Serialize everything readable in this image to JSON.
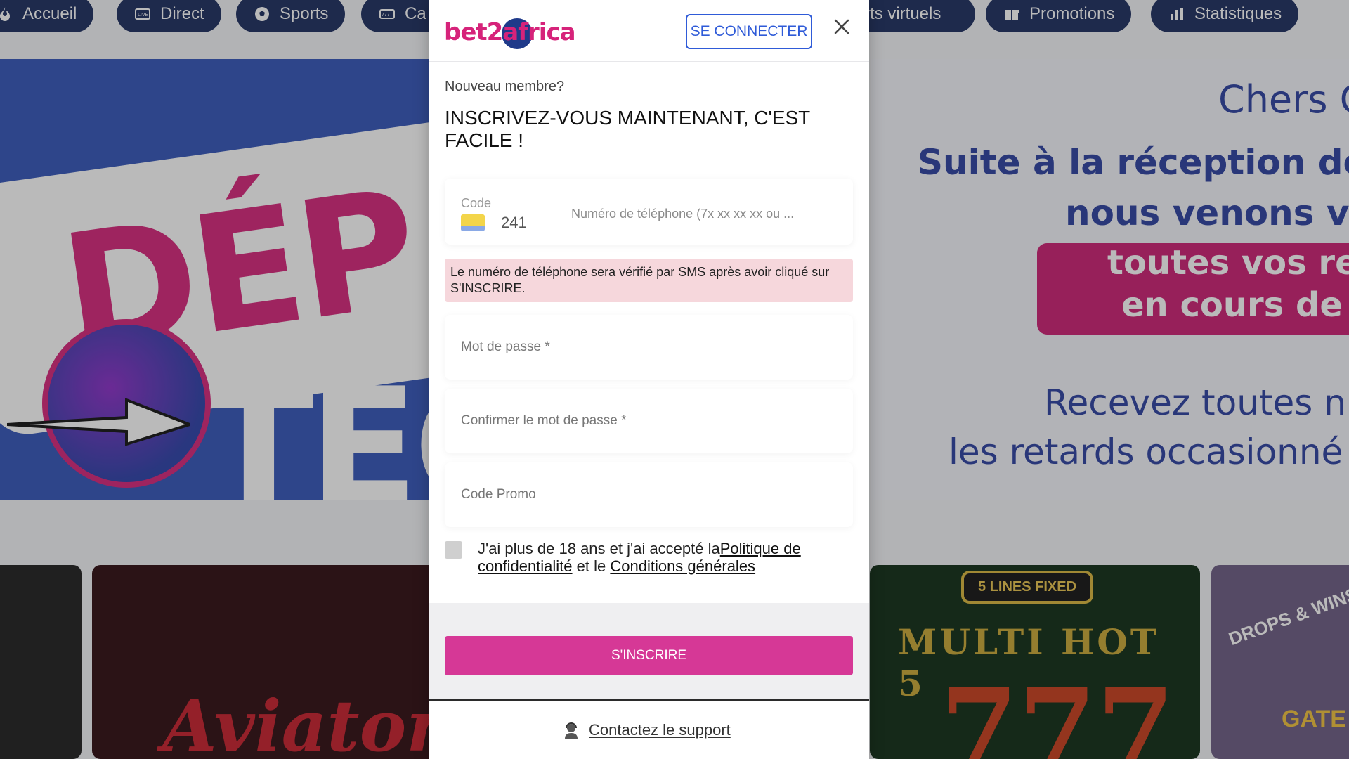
{
  "nav": {
    "items": [
      {
        "label": "Accueil",
        "icon": "fire-icon"
      },
      {
        "label": "Direct",
        "icon": "live-tv-icon"
      },
      {
        "label": "Sports",
        "icon": "soccer-ball-icon"
      },
      {
        "label": "Ca",
        "icon": "slot-machine-icon"
      },
      {
        "label": "rts virtuels",
        "icon": "virtual-sports-icon"
      },
      {
        "label": "Promotions",
        "icon": "gift-icon"
      },
      {
        "label": "Statistiques",
        "icon": "bar-chart-icon"
      }
    ]
  },
  "banner_left": {
    "line1": "DÉP",
    "line2": "TEC"
  },
  "banner_right": {
    "line1": "Chers C",
    "line2": "Suite à la réception de v",
    "line3": "nous venons vo",
    "highlight1": "toutes vos re",
    "highlight2": "en cours de",
    "line4": "Recevez toutes n",
    "line5": "les retards occasionné"
  },
  "games": {
    "aviator": "Aviator",
    "multi_badge": "5 LINES FIXED",
    "multi_title": "MULTI HOT 5",
    "multi_sevens": "777",
    "drops": "DROPS & WINS",
    "gate": "GATE"
  },
  "modal": {
    "logo_text": "bet2africa",
    "connect_label": "SE CONNECTER",
    "subtitle": "Nouveau membre?",
    "headline": "INSCRIVEZ-VOUS MAINTENANT, C'EST FACILE !",
    "phone": {
      "code_label": "Code",
      "code_value": "241",
      "placeholder": "Numéro de téléphone (7x xx xx xx ou ...",
      "flag_colors": [
        "#f3d54a",
        "#f3d54a",
        "#8aa9e6"
      ]
    },
    "sms_note": "Le numéro de téléphone sera vérifié par SMS après avoir cliqué sur S'INSCRIRE.",
    "password_placeholder": "Mot de passe *",
    "confirm_placeholder": "Confirmer le mot de passe *",
    "promo_placeholder": "Code Promo",
    "consent_prefix": "J'ai plus de 18 ans et j'ai accepté la",
    "privacy_link": "Politique de confidentialité",
    "consent_middle": " et le ",
    "terms_link": "Conditions générales",
    "submit_label": "S'INSCRIRE",
    "support_label": "Contactez le support"
  },
  "colors": {
    "brand_pink": "#d63896",
    "brand_blue": "#2f5bd8",
    "nav_bg": "#1a2b5e"
  }
}
